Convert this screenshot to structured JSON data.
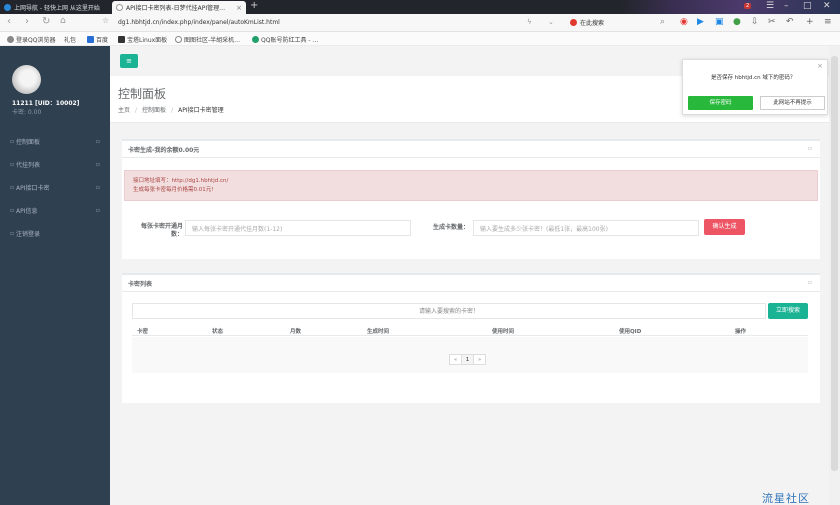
{
  "browser": {
    "tabs": [
      {
        "title": "上网导航 - 轻快上网 从这里开始"
      },
      {
        "title": "API接口卡密列表-日梦代挂API管理…",
        "active": true
      }
    ],
    "tab_close": "×",
    "new_tab": "+",
    "badge_count": "2",
    "url": "dg1.hbhtjd.cn/index.php/index/panel/autoKmList.html",
    "search_placeholder": "在此搜索",
    "bookmarks": [
      {
        "label": "登录QQ浏览器",
        "color": "#777"
      },
      {
        "label": "礼包",
        "color": ""
      },
      {
        "label": "百度",
        "color": "#2a6fd6"
      },
      {
        "label": "宝塔Linux面板",
        "color": "#333"
      },
      {
        "label": "图图社区-半胡采机…",
        "color": "#666"
      },
      {
        "label": "QQ账号防红工具 - …",
        "color": "#21a06b"
      }
    ]
  },
  "sidebar": {
    "user_name": "11211 [UID：10002]",
    "balance": "卡密: 0.00",
    "items": [
      {
        "label": "控制面板"
      },
      {
        "label": "代挂列表"
      },
      {
        "label": "API接口卡密"
      },
      {
        "label": "API信息"
      },
      {
        "label": "注销登录"
      }
    ]
  },
  "topbar": {
    "toggle_label": "≡"
  },
  "heading": {
    "title": "控制面板",
    "breadcrumb": [
      "主页",
      "控制面板",
      "API接口卡密管理"
    ]
  },
  "generate_panel": {
    "title": "卡密生成-我的余额0.00元",
    "alert_line1": "接口地址填写：http://dg1.hbhtjd.cn/",
    "alert_line2": "生成每张卡密每月价格需0.01元!",
    "months_label": "每张卡密开通月数：",
    "months_placeholder": "输入每张卡密开通代挂月数(1-12)",
    "count_label": "生成卡数量：",
    "count_placeholder": "输入要生成多少张卡密！(最低1张，最高100张)",
    "submit_label": "确认生成"
  },
  "list_panel": {
    "title": "卡密列表",
    "search_placeholder": "请输入要搜索的卡密！",
    "search_button": "立即搜索",
    "columns": [
      "卡密",
      "状态",
      "月数",
      "生成时间",
      "使用时间",
      "使用QID",
      "操作"
    ],
    "pager": [
      "«",
      "1",
      "»"
    ]
  },
  "password_popup": {
    "question": "是否保存 hbhtjd.cn 域下的密码？",
    "save_label": "保存密码",
    "never_label": "此网站不再提示",
    "close": "×"
  },
  "watermark": "流星社区",
  "colors": {
    "sidebar_bg": "#2f4050",
    "primary": "#1ab394",
    "danger": "#ed5565",
    "alert_bg": "#f2dede",
    "alert_text": "#a94442",
    "save_green": "#28b93c"
  }
}
